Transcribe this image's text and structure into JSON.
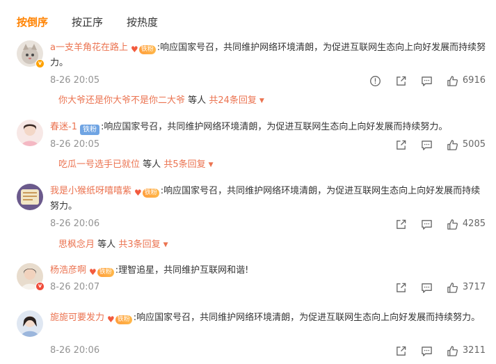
{
  "tabs": [
    {
      "label": "按倒序",
      "active": true
    },
    {
      "label": "按正序",
      "active": false
    },
    {
      "label": "按热度",
      "active": false
    }
  ],
  "comments": [
    {
      "username": "a一支羊角花在路上",
      "fan_badge": "铁粉",
      "text": ":响应国家号召，共同维护网络环境清朗，为促进互联网生态向上向好发展而持续努力。",
      "time": "8-26 20:05",
      "likes": "6916",
      "reply_preview": {
        "user": "你大爷还是你大爷不是你二大爷",
        "middle": "等人",
        "count": "共24条回复"
      }
    },
    {
      "username": "春迷-1",
      "fan_badge": "铁粉",
      "text": ":响应国家号召，共同维护网络环境清朗，为促进互联网生态向上向好发展而持续努力。",
      "time": "8-26 20:05",
      "likes": "5005",
      "reply_preview": {
        "user": "吃瓜一号选手已就位",
        "middle": "等人",
        "count": "共5条回复"
      }
    },
    {
      "username": "我是小猴纸呀嘻嘻紫",
      "fan_badge": "铁粉",
      "text": ":响应国家号召，共同维护网络环境清朗，为促进互联网生态向上向好发展而持续努力。",
      "time": "8-26 20:06",
      "likes": "4285",
      "reply_preview": {
        "user": "思枫念月",
        "middle": "等人",
        "count": "共3条回复"
      }
    },
    {
      "username": "杨浩彦啊",
      "fan_badge": "铁粉",
      "text": ":理智追星，共同维护互联网和谐!",
      "time": "8-26 20:07",
      "likes": "3717"
    },
    {
      "username": "旎旎可要发力",
      "fan_badge": "铁粉",
      "text": ":响应国家号召，共同维护网络环境清朗，为促进互联网生态向上向好发展而持续努力。",
      "time": "8-26 20:06",
      "likes": "3211"
    }
  ],
  "colors": {
    "accent": "#ff8200",
    "username": "#eb7350",
    "meta": "#939393",
    "verified_orange": "#ffa200",
    "verified_red": "#f04d3b"
  },
  "icons": [
    "report-icon",
    "share-icon",
    "comment-icon",
    "like-icon",
    "verified-badge-icon",
    "fan-heart-icon",
    "caret-down-icon"
  ]
}
